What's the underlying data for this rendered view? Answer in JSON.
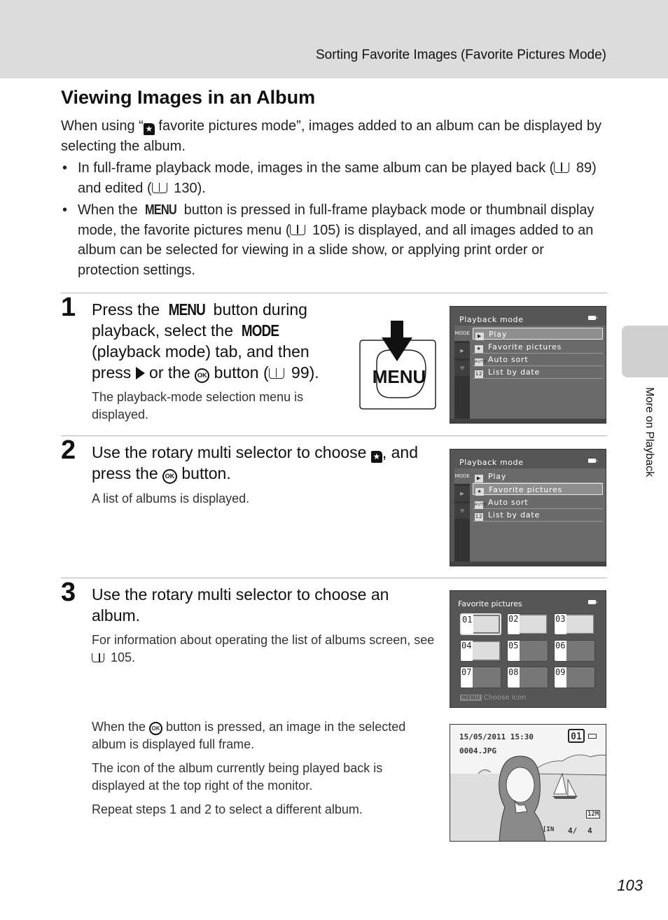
{
  "header": {
    "section_title": "Sorting Favorite Images (Favorite Pictures Mode)"
  },
  "page_title": "Viewing Images in an Album",
  "intro": {
    "before_icon": "When using “",
    "after_icon": " favorite pictures mode”, images added to an album can be displayed by selecting the album.",
    "bullets": [
      {
        "parts": [
          "In full-frame playback mode, images in the same album can be played back (",
          " 89) and edited (",
          " 130)."
        ]
      },
      {
        "parts": [
          "When the ",
          "MENU",
          " button is pressed in full-frame playback mode or thumbnail display mode, the favorite pictures menu (",
          " 105) is displayed, and all images added to an album can be selected for viewing in a slide show, or applying print order or protection settings."
        ]
      }
    ]
  },
  "steps": [
    {
      "number": "1",
      "heading_parts": [
        "Press the ",
        "MENU",
        " button during playback, select the ",
        "MODE",
        " (playback mode) tab, and then press ",
        " or the ",
        " button (",
        " 99)."
      ],
      "note": "The playback-mode selection menu is displayed.",
      "illustration_label": "MENU"
    },
    {
      "number": "2",
      "heading_parts": [
        "Use the rotary multi selector to choose ",
        ", and press the ",
        " button."
      ],
      "note": "A list of albums is displayed."
    },
    {
      "number": "3",
      "heading": "Use the rotary multi selector to choose an album.",
      "note_parts": [
        "For information about operating the list of albums screen, see ",
        " 105."
      ],
      "after_notes": [
        {
          "parts": [
            "When the ",
            " button is pressed, an image in the selected album is displayed full frame."
          ]
        },
        {
          "text": "The icon of the album currently being played back is displayed at the top right of the monitor."
        },
        {
          "text": "Repeat steps 1 and 2 to select a different album."
        }
      ]
    }
  ],
  "screen1": {
    "title": "Playback mode",
    "tabs": [
      "MODE",
      "▶",
      "⚒"
    ],
    "items": [
      {
        "icon": "▶",
        "label": "Play",
        "selected": true
      },
      {
        "icon": "★",
        "label": "Favorite pictures",
        "selected": false
      },
      {
        "icon": "AUTO",
        "label": "Auto sort",
        "selected": false
      },
      {
        "icon": "12",
        "label": "List by date",
        "selected": false
      }
    ]
  },
  "screen2": {
    "title": "Playback mode",
    "tabs": [
      "MODE",
      "▶",
      "⚒"
    ],
    "items": [
      {
        "icon": "▶",
        "label": "Play",
        "selected": false
      },
      {
        "icon": "★",
        "label": "Favorite pictures",
        "selected": true
      },
      {
        "icon": "AUTO",
        "label": "Auto sort",
        "selected": false
      },
      {
        "icon": "12",
        "label": "List by date",
        "selected": false
      }
    ]
  },
  "screen3": {
    "title": "Favorite pictures",
    "albums": [
      "01",
      "02",
      "03",
      "04",
      "05",
      "06",
      "07",
      "08",
      "09"
    ],
    "selected_album": "01",
    "albums_with_images": [
      "01",
      "02",
      "03",
      "04"
    ],
    "footer_button": "MENU",
    "footer_text": "Choose icon"
  },
  "screen4": {
    "datetime": "15/05/2011 15:30",
    "filename": "0004.JPG",
    "album_icon": "01",
    "image_size": "12M",
    "counter": "4/",
    "total": "4"
  },
  "sidebar": {
    "label": "More on Playback"
  },
  "page_number": "103"
}
